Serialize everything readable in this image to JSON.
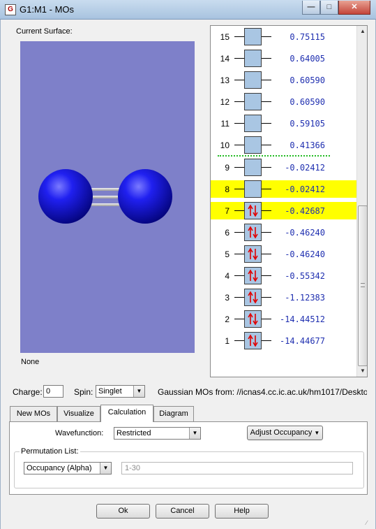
{
  "window": {
    "title": "G1:M1 - MOs",
    "app_icon": "gaussview-icon"
  },
  "surface": {
    "label": "Current Surface:",
    "value": "None",
    "background": "#7e80c9",
    "atom_color": "#1010e0"
  },
  "mo_list": {
    "homo_lumo_marker": "dotted-green",
    "rows": [
      {
        "num": "15",
        "energy": "0.75115",
        "occupancy": 0,
        "highlight": false
      },
      {
        "num": "14",
        "energy": "0.64005",
        "occupancy": 0,
        "highlight": false
      },
      {
        "num": "13",
        "energy": "0.60590",
        "occupancy": 0,
        "highlight": false
      },
      {
        "num": "12",
        "energy": "0.60590",
        "occupancy": 0,
        "highlight": false
      },
      {
        "num": "11",
        "energy": "0.59105",
        "occupancy": 0,
        "highlight": false
      },
      {
        "num": "10",
        "energy": "0.41366",
        "occupancy": 0,
        "highlight": false
      },
      {
        "num": "9",
        "energy": "-0.02412",
        "occupancy": 0,
        "highlight": false
      },
      {
        "num": "8",
        "energy": "-0.02412",
        "occupancy": 0,
        "highlight": true
      },
      {
        "num": "7",
        "energy": "-0.42687",
        "occupancy": 2,
        "highlight": true
      },
      {
        "num": "6",
        "energy": "-0.46240",
        "occupancy": 2,
        "highlight": false
      },
      {
        "num": "5",
        "energy": "-0.46240",
        "occupancy": 2,
        "highlight": false
      },
      {
        "num": "4",
        "energy": "-0.55342",
        "occupancy": 2,
        "highlight": false
      },
      {
        "num": "3",
        "energy": "-1.12383",
        "occupancy": 2,
        "highlight": false
      },
      {
        "num": "2",
        "energy": "-14.44512",
        "occupancy": 2,
        "highlight": false
      },
      {
        "num": "1",
        "energy": "-14.44677",
        "occupancy": 2,
        "highlight": false
      }
    ]
  },
  "settings": {
    "charge_label": "Charge:",
    "charge_value": "0",
    "spin_label": "Spin:",
    "spin_value": "Singlet",
    "source_text": "Gaussian MOs from:  //icnas4.cc.ic.ac.uk/hm1017/Deskto"
  },
  "tabs": [
    {
      "label": "New MOs",
      "active": false
    },
    {
      "label": "Visualize",
      "active": false
    },
    {
      "label": "Calculation",
      "active": true
    },
    {
      "label": "Diagram",
      "active": false
    }
  ],
  "calculation": {
    "wavefunction_label": "Wavefunction:",
    "wavefunction_value": "Restricted",
    "adjust_occupancy_label": "Adjust Occupancy",
    "permutation_title": "Permutation List:",
    "permutation_select": "Occupancy (Alpha)",
    "permutation_range": "1-30"
  },
  "footer": {
    "ok": "Ok",
    "cancel": "Cancel",
    "help": "Help"
  },
  "colors": {
    "highlight": "#ffff00",
    "energy_text": "#1f2fb0",
    "mo_box": "#a9c6e3",
    "electron_arrow": "#e00000",
    "homo_lumo_line": "#22bb22"
  }
}
